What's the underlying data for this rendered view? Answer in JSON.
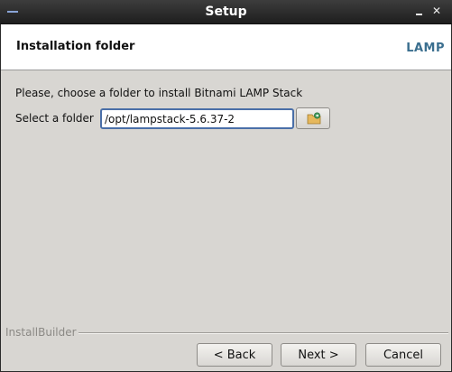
{
  "window": {
    "title": "Setup",
    "menu_icon": "window-menu-icon",
    "minimize_icon": "minimize-icon",
    "close_icon": "close-icon",
    "close_glyph": "✕"
  },
  "header": {
    "title": "Installation folder",
    "logo": "LAMP"
  },
  "main": {
    "instruction": "Please, choose a folder to install Bitnami LAMP Stack",
    "folder_label": "Select a folder",
    "folder_value": "/opt/lampstack-5.6.37-2",
    "browse_icon": "folder-browse-icon"
  },
  "footer": {
    "brand": "InstallBuilder",
    "back_label": "< Back",
    "next_label": "Next >",
    "cancel_label": "Cancel"
  }
}
